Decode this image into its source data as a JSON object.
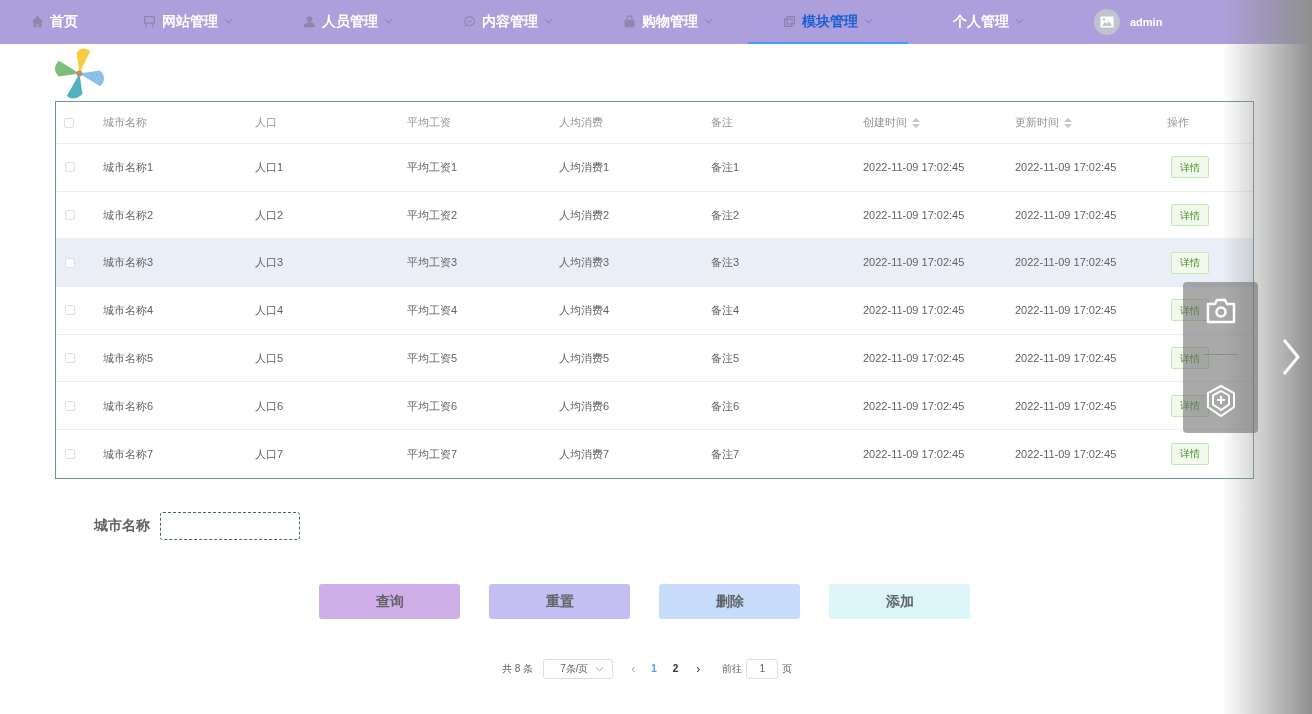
{
  "nav": {
    "items": [
      {
        "label": "首页",
        "kind": "link",
        "selected": false
      },
      {
        "label": "网站管理",
        "kind": "dropdown",
        "selected": false
      },
      {
        "label": "人员管理",
        "kind": "dropdown",
        "selected": false
      },
      {
        "label": "内容管理",
        "kind": "dropdown",
        "selected": false
      },
      {
        "label": "购物管理",
        "kind": "dropdown",
        "selected": false
      },
      {
        "label": "模块管理",
        "kind": "dropdown",
        "selected": true
      },
      {
        "label": "个人管理",
        "kind": "dropdown",
        "selected": false
      }
    ],
    "user": {
      "name": "admin"
    }
  },
  "table": {
    "columns": [
      {
        "label": "城市名称",
        "kind": "plain"
      },
      {
        "label": "人口",
        "kind": "plain"
      },
      {
        "label": "平均工资",
        "kind": "plain"
      },
      {
        "label": "人均消费",
        "kind": "plain"
      },
      {
        "label": "备注",
        "kind": "plain"
      },
      {
        "label": "创建时间",
        "kind": "sortable"
      },
      {
        "label": "更新时间",
        "kind": "sortable"
      },
      {
        "label": "操作",
        "kind": "plain"
      }
    ],
    "header_checked": false,
    "rows": [
      {
        "checked": false,
        "highlighted": false,
        "cells": [
          "城市名称1",
          "人口1",
          "平均工资1",
          "人均消费1",
          "备注1",
          "2022-11-09 17:02:45",
          "2022-11-09 17:02:45"
        ],
        "action": "详情"
      },
      {
        "checked": false,
        "highlighted": false,
        "cells": [
          "城市名称2",
          "人口2",
          "平均工资2",
          "人均消费2",
          "备注2",
          "2022-11-09 17:02:45",
          "2022-11-09 17:02:45"
        ],
        "action": "详情"
      },
      {
        "checked": false,
        "highlighted": true,
        "cells": [
          "城市名称3",
          "人口3",
          "平均工资3",
          "人均消费3",
          "备注3",
          "2022-11-09 17:02:45",
          "2022-11-09 17:02:45"
        ],
        "action": "详情"
      },
      {
        "checked": false,
        "highlighted": false,
        "cells": [
          "城市名称4",
          "人口4",
          "平均工资4",
          "人均消费4",
          "备注4",
          "2022-11-09 17:02:45",
          "2022-11-09 17:02:45"
        ],
        "action": "详情"
      },
      {
        "checked": false,
        "highlighted": false,
        "cells": [
          "城市名称5",
          "人口5",
          "平均工资5",
          "人均消费5",
          "备注5",
          "2022-11-09 17:02:45",
          "2022-11-09 17:02:45"
        ],
        "action": "详情"
      },
      {
        "checked": false,
        "highlighted": false,
        "cells": [
          "城市名称6",
          "人口6",
          "平均工资6",
          "人均消费6",
          "备注6",
          "2022-11-09 17:02:45",
          "2022-11-09 17:02:45"
        ],
        "action": "详情"
      },
      {
        "checked": false,
        "highlighted": false,
        "cells": [
          "城市名称7",
          "人口7",
          "平均工资7",
          "人均消费7",
          "备注7",
          "2022-11-09 17:02:45",
          "2022-11-09 17:02:45"
        ],
        "action": "详情"
      }
    ]
  },
  "search": {
    "label": "城市名称"
  },
  "buttons": [
    {
      "label": "查询",
      "color": "#d0afe9"
    },
    {
      "label": "重置",
      "color": "#c3bff0"
    },
    {
      "label": "删除",
      "color": "#c7dcfb"
    },
    {
      "label": "添加",
      "color": "#dbf5f9"
    }
  ],
  "pagination": {
    "total": "共 8 条",
    "page_size": "7条/页",
    "prev": "‹",
    "pages": [
      {
        "label": "1",
        "selected": true
      },
      {
        "label": "2",
        "selected": false
      }
    ],
    "next": "›",
    "goto_label": "前往",
    "goto_value": "1",
    "goto_suffix": "页"
  }
}
